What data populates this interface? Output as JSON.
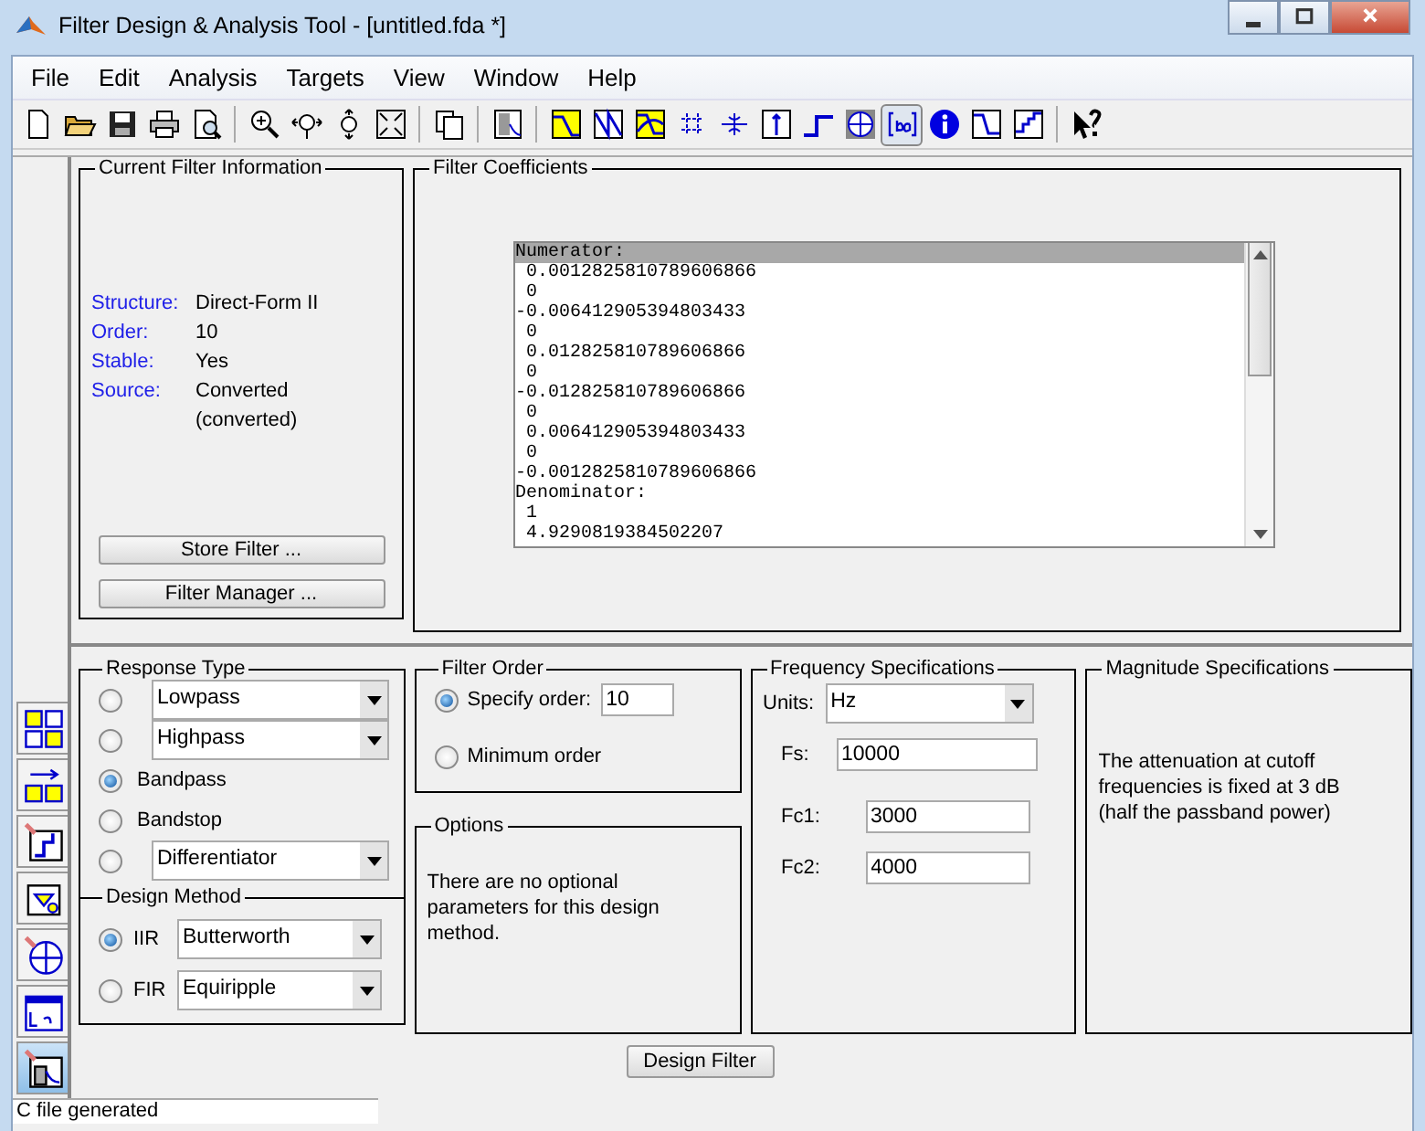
{
  "window": {
    "title": "Filter Design & Analysis Tool -  [untitled.fda *]"
  },
  "menu": [
    "File",
    "Edit",
    "Analysis",
    "Targets",
    "View",
    "Window",
    "Help"
  ],
  "toolbar": [
    {
      "selected": false
    },
    {
      "selected": false
    },
    {
      "selected": false
    },
    {
      "selected": false
    },
    {
      "selected": false
    },
    {
      "selected": false
    },
    {
      "selected": false
    },
    {
      "selected": false
    },
    {
      "selected": false
    },
    {
      "selected": false
    },
    {
      "selected": false
    },
    {
      "selected": false
    },
    {
      "selected": false
    },
    {
      "selected": false
    },
    {
      "selected": false
    },
    {
      "selected": false
    },
    {
      "selected": false
    },
    {
      "selected": false
    },
    {
      "selected": false
    },
    {
      "selected": true
    },
    {
      "selected": false
    },
    {
      "selected": false
    },
    {
      "selected": false
    },
    {
      "selected": false
    }
  ],
  "side_tabs": [
    {
      "selected": false
    },
    {
      "selected": false
    },
    {
      "selected": false
    },
    {
      "selected": false
    },
    {
      "selected": false
    },
    {
      "selected": false
    },
    {
      "selected": true
    }
  ],
  "current_filter": {
    "title": "Current Filter Information",
    "rows": [
      {
        "label": "Structure:",
        "value": "Direct-Form II"
      },
      {
        "label": "Order:",
        "value": "10"
      },
      {
        "label": "Stable:",
        "value": "Yes"
      },
      {
        "label": "Source:",
        "value": "Converted (converted)"
      }
    ],
    "buttons": [
      "Store Filter ...",
      "Filter Manager ..."
    ]
  },
  "coefficients": {
    "title": "Filter Coefficients",
    "lines": [
      {
        "text": "Numerator:",
        "selected": true
      },
      {
        "text": " 0.0012825810789606866",
        "selected": false
      },
      {
        "text": " 0",
        "selected": false
      },
      {
        "text": "-0.006412905394803433",
        "selected": false
      },
      {
        "text": " 0",
        "selected": false
      },
      {
        "text": " 0.012825810789606866",
        "selected": false
      },
      {
        "text": " 0",
        "selected": false
      },
      {
        "text": "-0.012825810789606866",
        "selected": false
      },
      {
        "text": " 0",
        "selected": false
      },
      {
        "text": " 0.006412905394803433",
        "selected": false
      },
      {
        "text": " 0",
        "selected": false
      },
      {
        "text": "-0.0012825810789606866",
        "selected": false
      },
      {
        "text": "Denominator:",
        "selected": false
      },
      {
        "text": " 1",
        "selected": false
      },
      {
        "text": " 4.9290819384502207",
        "selected": false
      }
    ]
  },
  "response_type": {
    "title": "Response Type",
    "items": [
      {
        "kind": "dropdown",
        "label": "Lowpass",
        "selected": false
      },
      {
        "kind": "dropdown",
        "label": "Highpass",
        "selected": false
      },
      {
        "kind": "label",
        "label": "Bandpass",
        "selected": true
      },
      {
        "kind": "label",
        "label": "Bandstop",
        "selected": false
      },
      {
        "kind": "dropdown",
        "label": "Differentiator",
        "selected": false
      }
    ]
  },
  "design_method": {
    "title": "Design Method",
    "items": [
      {
        "label": "IIR",
        "value": "Butterworth",
        "selected": true
      },
      {
        "label": "FIR",
        "value": "Equiripple",
        "selected": false
      }
    ]
  },
  "filter_order": {
    "title": "Filter Order",
    "items": [
      {
        "kind": "field",
        "label": "Specify order:",
        "value": "10",
        "selected": true
      },
      {
        "kind": "label",
        "label": "Minimum order",
        "selected": false
      }
    ]
  },
  "options": {
    "title": "Options",
    "text": "There are no optional parameters for this design method."
  },
  "frequency": {
    "title": "Frequency Specifications",
    "units_label": "Units:",
    "units": "Hz",
    "fields": [
      {
        "label": "Fs:",
        "value": "10000"
      },
      {
        "label": "Fc1:",
        "value": "3000"
      },
      {
        "label": "Fc2:",
        "value": "4000"
      }
    ]
  },
  "magnitude": {
    "title": "Magnitude Specifications",
    "text": "The attenuation at cutoff frequencies is fixed at 3 dB (half the passband power)"
  },
  "design_button": "Design Filter",
  "status_bar": "C file generated"
}
